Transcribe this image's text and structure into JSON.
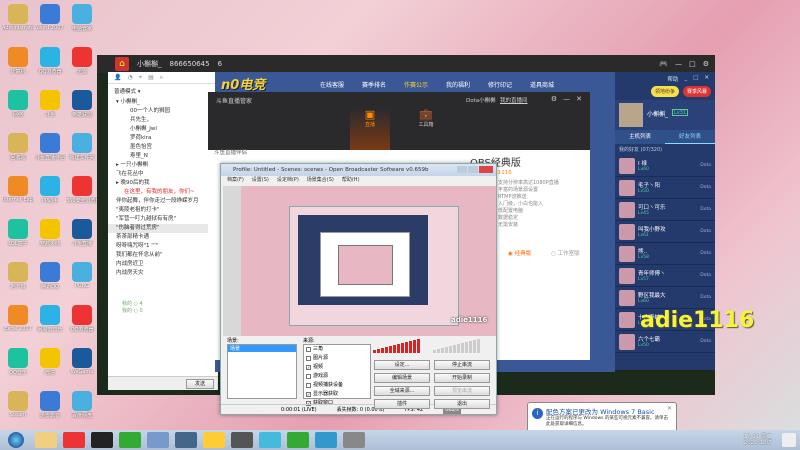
{
  "desktop": {
    "icons": [
      [
        "Administrator",
        "Word 2007",
        "电脑管家"
      ],
      [
        "计算机",
        "QQ浏览器",
        "迅雷"
      ],
      [
        "网络",
        "斗鱼",
        "英雄联盟"
      ],
      [
        "回收站",
        "斗鱼直播伴侣",
        "新建文件夹"
      ],
      [
        "Internet Explorer",
        "PP助手",
        "360安全浏览器"
      ],
      [
        "LOL盒子",
        "穿越火线",
        "斗鱼直播"
      ],
      [
        "地下城",
        "腾讯QQ",
        "PUBG"
      ],
      [
        "Excel 2007",
        "网易云音乐",
        "QQ浏览器"
      ],
      [
        "QQ音乐",
        "微信",
        "WeGame"
      ],
      [
        "Steam",
        "迅雷影音",
        "百度网盘"
      ]
    ],
    "colors": [
      "#d9b55a",
      "#3a7bd5",
      "#4ab0e0",
      "#f08a24",
      "#2bb3e6",
      "#e33",
      "#1dc2a0",
      "#f5c400",
      "#1a5a9a"
    ]
  },
  "gamewin": {
    "title": "小槲槲_",
    "id": "866650645",
    "count": "6"
  },
  "yy": {
    "mode": "普通模式 ▾",
    "rows": [
      "▾ 小槲槲_",
      "00一个人的狮园",
      "兵先生，",
      "小槲槲_Jwl",
      "罗荷kira",
      "墨色怡宫",
      "寿里_N",
      "▸ 一只小槲槲",
      "飞在花丛中",
      "▸ 晚90后的我",
      "在这里，有我的朋友，你们~",
      "伴你起舞，伴你走过一段峥嵘岁月",
      "\"夷陵老祖的打卡\"",
      "\"军营一叮九越狱有有房\"",
      "\"伤脑者得过荒房\"",
      "茶茶部精卡通",
      "呀呀嗨咒呀\"1 '''\"",
      "我们都在怀念从前\"",
      "内战房近卫",
      "内战房天灾"
    ],
    "footer": [
      "我的 ○ 4",
      "我的 ○ 0"
    ],
    "send": "发送"
  },
  "n0": {
    "logo": "n0电竞",
    "nav": [
      "在线客服",
      "赛季排名",
      "作赛公示",
      "我的福利",
      "修行印记",
      "道具商城"
    ],
    "help": "帮助",
    "btn_yellow": "领地纷争",
    "btn_red": "赛季风暴"
  },
  "friends": {
    "user": "小槲槲_",
    "level": "Lv31",
    "tabs": [
      "主机列表",
      "好友列表"
    ],
    "group": "我的好友 (07/320)",
    "items": [
      {
        "name": "I 禄",
        "lv": "Lv60"
      },
      {
        "name": "毛子丶阳",
        "lv": "Lv50"
      },
      {
        "name": "可口丶可乐",
        "lv": "Lv45"
      },
      {
        "name": "叫我小野攻",
        "lv": "Lv61"
      },
      {
        "name": "熊..",
        "lv": "Lv58"
      },
      {
        "name": "青年师傅丶",
        "lv": "Lv57"
      },
      {
        "name": "野区我最大",
        "lv": "Lv60"
      },
      {
        "name": "十六秦蛇",
        "lv": "Lv44"
      },
      {
        "name": "六个七霸",
        "lv": "Lv50"
      }
    ],
    "status": "Dota"
  },
  "douyu": {
    "title": "斗鱼直播管家",
    "user": "Dota小槲槲",
    "my_room": "我的直播间",
    "tabs": [
      "直播",
      "工具箱"
    ],
    "sidebar": "斗鱼直播伴侣",
    "obs_title": "OBS经典版",
    "obs_link": "adie1116",
    "obs_desc": [
      "支持分辨率高达1080P直播",
      "丰富的场景源设置",
      "RTMP流推送",
      "入门级，小白也能入",
      "低配置电脑",
      "数据稳定",
      "无需安装"
    ],
    "options": [
      "经典版",
      "工作室版"
    ]
  },
  "obs": {
    "title": "Profile: Untitled - Scenes: scenes - Open Broadcaster Software v0.659b",
    "menu": [
      "档案(F)",
      "设置(S)",
      "设定档(P)",
      "场景集合(S)",
      "帮助(H)"
    ],
    "scenes_label": "场景:",
    "sources_label": "来源:",
    "scenes": [
      "场景"
    ],
    "sources": [
      {
        "name": "三角",
        "checked": false
      },
      {
        "name": "图片源",
        "checked": false
      },
      {
        "name": "视频",
        "checked": true
      },
      {
        "name": "游戏源",
        "checked": false
      },
      {
        "name": "视频捕获设备",
        "checked": false
      },
      {
        "name": "显示器获取",
        "checked": true
      },
      {
        "name": "获取窗口",
        "checked": true
      }
    ],
    "buttons": [
      "设定...",
      "停止串流",
      "编辑场景",
      "开始录制",
      "全域来源...",
      "预览串流",
      "插件",
      "退出"
    ],
    "status": {
      "time": "0:00:01 (LIVE)",
      "dropped": "丢失帧数: 0 (0.00%)",
      "fps": "FPS: 42",
      "kbps": "0kb/s"
    }
  },
  "overlay": {
    "watermark": "adie1116"
  },
  "balloon": {
    "title": "配色方案已更改为 Windows 7 Basic",
    "body": "正在运行的程序与 Windows 的某些可视元素不兼容。请单击此处获取详细信息。"
  },
  "clock": {
    "time": "17:21 周二",
    "date": "2021/12/7"
  }
}
